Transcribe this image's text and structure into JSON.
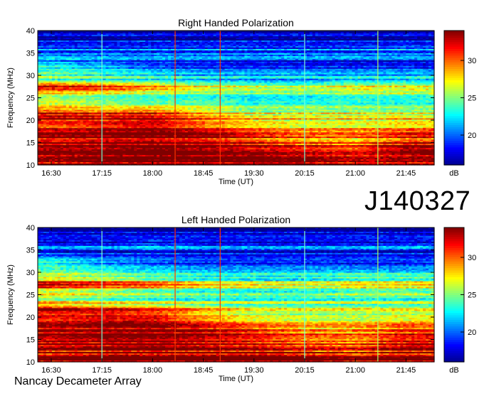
{
  "observation_id": "J140327",
  "instrument": "Nancay Decameter Array",
  "colors": {
    "colormap": [
      "#00008f",
      "#0000ff",
      "#007fff",
      "#00ffff",
      "#7fff7f",
      "#ffff00",
      "#ff7f00",
      "#ff0000",
      "#7f0000"
    ]
  },
  "chart_data": [
    {
      "type": "heatmap",
      "title": "Right Handed Polarization",
      "xlabel": "Time (UT)",
      "ylabel": "Frequency (MHz)",
      "xlim": [
        "16:18",
        "22:10"
      ],
      "ylim": [
        10,
        40
      ],
      "x_ticks": [
        "16:30",
        "17:15",
        "18:00",
        "18:45",
        "19:30",
        "20:15",
        "21:00",
        "21:45"
      ],
      "y_ticks": [
        10,
        15,
        20,
        25,
        30,
        35,
        40
      ],
      "colorbar": {
        "label": "dB",
        "range": [
          16,
          34
        ],
        "ticks": [
          20,
          25,
          30
        ]
      },
      "vertical_markers": [
        {
          "time": "17:15",
          "color": "#7fffd4"
        },
        {
          "time": "18:20",
          "color": "#ff3300"
        },
        {
          "time": "19:00",
          "color": "#ff3300"
        },
        {
          "time": "20:15",
          "color": "#7fffd4"
        },
        {
          "time": "21:20",
          "color": "#b0ff60"
        }
      ],
      "intensity_profile_db": {
        "frequency_mhz": [
          10,
          11,
          12,
          13,
          14,
          15,
          16,
          17,
          18,
          19,
          20,
          21,
          22,
          23,
          24,
          25,
          26,
          27,
          28,
          29,
          30,
          31,
          32,
          33,
          34,
          35,
          36,
          37,
          38,
          39,
          40
        ],
        "time_ut": [
          "16:30",
          "17:15",
          "18:00",
          "18:45",
          "19:30",
          "20:15",
          "21:00",
          "21:45"
        ],
        "db": [
          [
            33,
            34,
            34,
            34,
            34,
            34,
            33,
            33
          ],
          [
            33,
            34,
            34,
            34,
            34,
            34,
            32,
            33
          ],
          [
            32,
            33,
            33,
            33,
            33,
            32,
            31,
            32
          ],
          [
            33,
            33,
            34,
            33,
            32,
            31,
            30,
            33
          ],
          [
            33,
            33,
            34,
            33,
            32,
            31,
            30,
            33
          ],
          [
            33,
            34,
            34,
            33,
            32,
            30,
            30,
            32
          ],
          [
            33,
            34,
            34,
            33,
            31,
            30,
            29,
            31
          ],
          [
            33,
            33,
            34,
            33,
            31,
            29,
            29,
            31
          ],
          [
            32,
            33,
            34,
            32,
            30,
            29,
            29,
            30
          ],
          [
            32,
            33,
            34,
            31,
            29,
            28,
            28,
            29
          ],
          [
            32,
            32,
            33,
            30,
            28,
            27,
            27,
            28
          ],
          [
            33,
            32,
            32,
            29,
            27,
            27,
            27,
            27
          ],
          [
            31,
            30,
            31,
            28,
            26,
            26,
            26,
            26
          ],
          [
            28,
            27,
            27,
            26,
            25,
            25,
            25,
            25
          ],
          [
            27,
            26,
            25,
            25,
            24,
            24,
            24,
            24
          ],
          [
            26,
            25,
            24,
            24,
            23,
            23,
            24,
            24
          ],
          [
            27,
            26,
            25,
            24,
            24,
            24,
            25,
            25
          ],
          [
            32,
            31,
            29,
            27,
            26,
            26,
            27,
            27
          ],
          [
            31,
            30,
            28,
            26,
            25,
            25,
            26,
            26
          ],
          [
            25,
            24,
            24,
            23,
            22,
            22,
            23,
            23
          ],
          [
            24,
            23,
            22,
            21,
            21,
            21,
            21,
            21
          ],
          [
            23,
            22,
            21,
            20,
            20,
            20,
            20,
            20
          ],
          [
            25,
            23,
            21,
            20,
            20,
            20,
            20,
            20
          ],
          [
            22,
            21,
            20,
            20,
            19,
            19,
            19,
            19
          ],
          [
            20,
            19,
            19,
            19,
            19,
            19,
            19,
            19
          ],
          [
            19,
            19,
            19,
            19,
            19,
            19,
            19,
            19
          ],
          [
            20,
            20,
            20,
            20,
            20,
            20,
            20,
            21
          ],
          [
            18,
            18,
            18,
            18,
            18,
            18,
            18,
            18
          ],
          [
            18,
            18,
            18,
            18,
            18,
            18,
            18,
            18
          ],
          [
            17,
            17,
            17,
            17,
            17,
            17,
            17,
            17
          ],
          [
            17,
            17,
            17,
            17,
            17,
            17,
            17,
            17
          ]
        ]
      }
    },
    {
      "type": "heatmap",
      "title": "Left Handed Polarization",
      "xlabel": "Time (UT)",
      "ylabel": "Frequency (MHz)",
      "xlim": [
        "16:18",
        "22:10"
      ],
      "ylim": [
        10,
        40
      ],
      "x_ticks": [
        "16:30",
        "17:15",
        "18:00",
        "18:45",
        "19:30",
        "20:15",
        "21:00",
        "21:45"
      ],
      "y_ticks": [
        10,
        15,
        20,
        25,
        30,
        35,
        40
      ],
      "colorbar": {
        "label": "dB",
        "range": [
          16,
          34
        ],
        "ticks": [
          20,
          25,
          30
        ]
      },
      "vertical_markers": [
        {
          "time": "17:15",
          "color": "#7fffd4"
        },
        {
          "time": "18:20",
          "color": "#ff3300"
        },
        {
          "time": "19:00",
          "color": "#ff3300"
        },
        {
          "time": "20:15",
          "color": "#7fffd4"
        },
        {
          "time": "21:20",
          "color": "#b0ff60"
        }
      ],
      "intensity_profile_db": {
        "frequency_mhz": [
          10,
          11,
          12,
          13,
          14,
          15,
          16,
          17,
          18,
          19,
          20,
          21,
          22,
          23,
          24,
          25,
          26,
          27,
          28,
          29,
          30,
          31,
          32,
          33,
          34,
          35,
          36,
          37,
          38,
          39,
          40
        ],
        "time_ut": [
          "16:30",
          "17:15",
          "18:00",
          "18:45",
          "19:30",
          "20:15",
          "21:00",
          "21:45"
        ],
        "db": [
          [
            33,
            34,
            34,
            34,
            34,
            34,
            33,
            33
          ],
          [
            33,
            34,
            34,
            34,
            34,
            33,
            32,
            33
          ],
          [
            32,
            33,
            33,
            33,
            33,
            32,
            31,
            32
          ],
          [
            33,
            33,
            34,
            33,
            32,
            31,
            31,
            33
          ],
          [
            33,
            33,
            34,
            33,
            32,
            31,
            30,
            33
          ],
          [
            33,
            34,
            34,
            33,
            32,
            30,
            30,
            32
          ],
          [
            33,
            34,
            34,
            33,
            31,
            30,
            29,
            31
          ],
          [
            33,
            33,
            34,
            33,
            31,
            29,
            29,
            31
          ],
          [
            33,
            34,
            34,
            32,
            30,
            29,
            29,
            30
          ],
          [
            33,
            34,
            34,
            31,
            29,
            28,
            28,
            29
          ],
          [
            33,
            33,
            33,
            30,
            28,
            27,
            27,
            28
          ],
          [
            33,
            33,
            32,
            29,
            27,
            27,
            27,
            27
          ],
          [
            32,
            31,
            30,
            28,
            26,
            26,
            26,
            26
          ],
          [
            28,
            27,
            26,
            25,
            25,
            25,
            25,
            25
          ],
          [
            26,
            25,
            24,
            24,
            24,
            24,
            24,
            24
          ],
          [
            26,
            25,
            24,
            23,
            23,
            23,
            24,
            24
          ],
          [
            27,
            26,
            25,
            24,
            24,
            24,
            25,
            25
          ],
          [
            32,
            31,
            30,
            28,
            27,
            26,
            27,
            27
          ],
          [
            31,
            30,
            28,
            26,
            25,
            25,
            26,
            26
          ],
          [
            25,
            24,
            23,
            22,
            22,
            22,
            23,
            23
          ],
          [
            24,
            23,
            22,
            21,
            21,
            21,
            21,
            21
          ],
          [
            23,
            22,
            21,
            20,
            20,
            20,
            20,
            20
          ],
          [
            25,
            22,
            21,
            20,
            20,
            20,
            20,
            20
          ],
          [
            22,
            21,
            20,
            19,
            19,
            19,
            19,
            19
          ],
          [
            20,
            19,
            19,
            19,
            19,
            19,
            19,
            19
          ],
          [
            19,
            19,
            20,
            19,
            19,
            19,
            19,
            19
          ],
          [
            20,
            20,
            21,
            20,
            20,
            20,
            20,
            21
          ],
          [
            18,
            18,
            19,
            18,
            18,
            18,
            18,
            18
          ],
          [
            18,
            18,
            18,
            18,
            18,
            18,
            18,
            18
          ],
          [
            17,
            17,
            17,
            17,
            17,
            17,
            17,
            17
          ],
          [
            17,
            17,
            17,
            17,
            17,
            17,
            17,
            17
          ]
        ]
      }
    }
  ]
}
